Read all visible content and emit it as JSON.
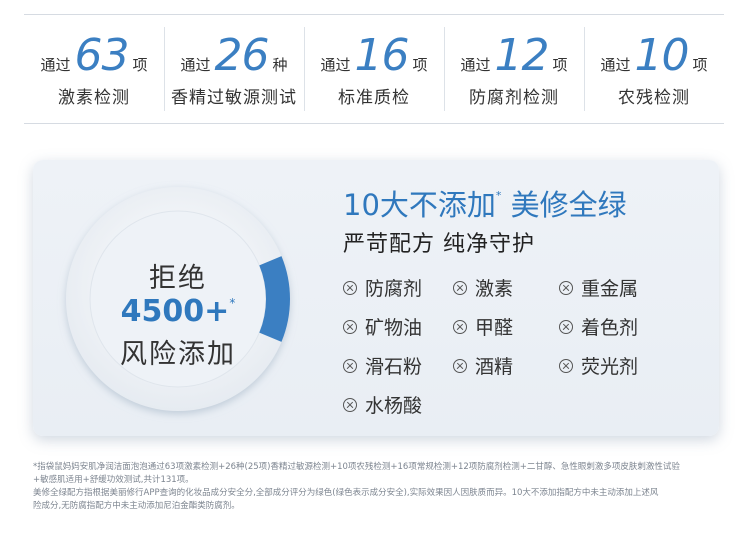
{
  "stats": [
    {
      "prefix": "通过",
      "number": "63",
      "suffix": "项",
      "desc": "激素检测"
    },
    {
      "prefix": "通过",
      "number": "26",
      "suffix": "种",
      "desc": "香精过敏源测试"
    },
    {
      "prefix": "通过",
      "number": "16",
      "suffix": "项",
      "desc": "标准质检"
    },
    {
      "prefix": "通过",
      "number": "12",
      "suffix": "项",
      "desc": "防腐剂检测"
    },
    {
      "prefix": "通过",
      "number": "10",
      "suffix": "项",
      "desc": "农残检测"
    }
  ],
  "ring": {
    "line1": "拒绝",
    "line2": "4500+",
    "line2_mark": "*",
    "line3": "风险添加",
    "highlight_fraction": 0.125,
    "accent": "#3b7fc2"
  },
  "headline": {
    "part1": "10大不添加",
    "mark": "*",
    "part2": "美修全绿"
  },
  "subhead": "严苛配方 纯净守护",
  "items": [
    "防腐剂",
    "激素",
    "重金属",
    "矿物油",
    "甲醛",
    "着色剂",
    "滑石粉",
    "酒精",
    "荧光剂",
    "水杨酸"
  ],
  "item_icon": "circle-x-icon",
  "footnote": {
    "line1": "*指袋鼠妈妈安肌净润洁面泡泡通过63项激素检测+26种(25项)香精过敏源检测+10项农残检测+16项常规检测+12项防腐剂检测+二甘醇、急性眼刺激多项皮肤刺激性试验",
    "line2": "+敏感肌适用+舒缓功效测试,共计131项。",
    "line3": "美修全绿配方指根据美丽修行APP查询的化妆品成分安全分,全部成分评分为绿色(绿色表示成分安全),实际效果因人因肤质而异。10大不添加指配方中未主动添加上述风",
    "line4": "险成分,无防腐指配方中未主动添加尼泊金酯类防腐剂。"
  }
}
